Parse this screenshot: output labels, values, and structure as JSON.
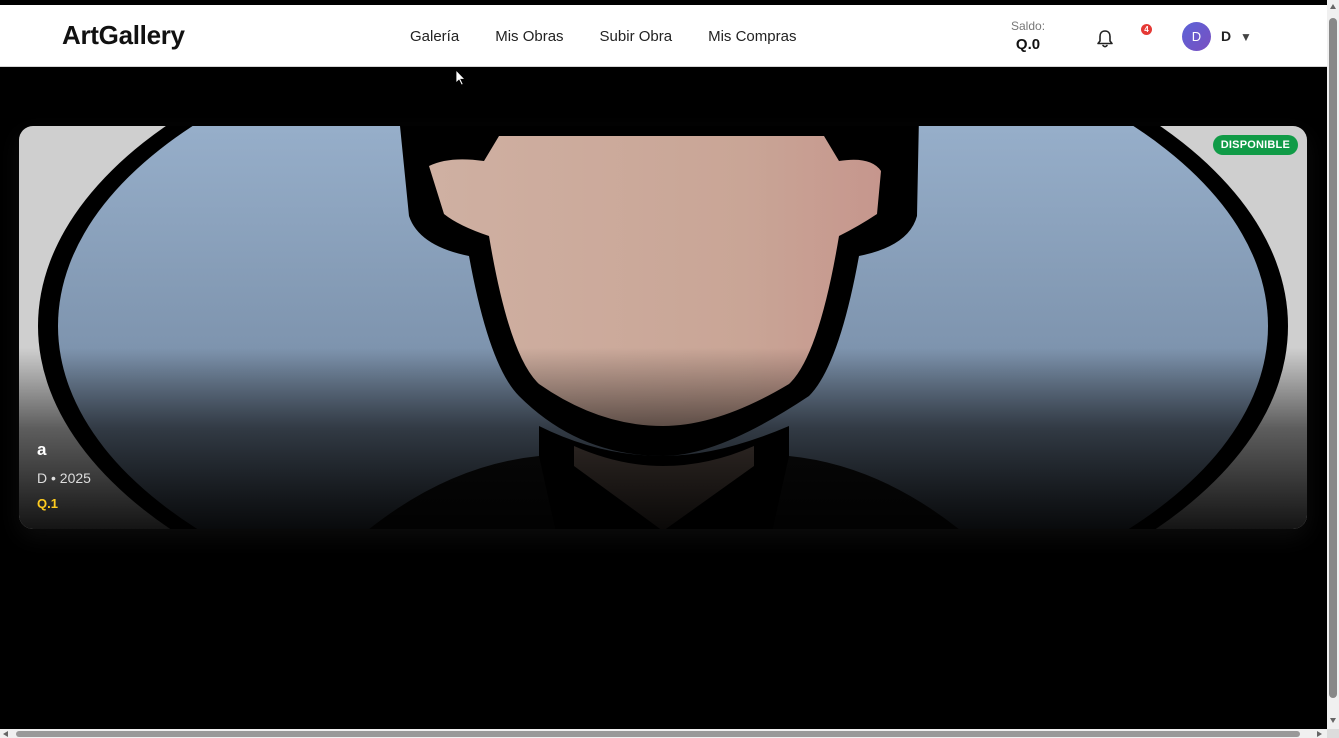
{
  "header": {
    "brand": "ArtGallery",
    "nav": [
      {
        "label": "Galería"
      },
      {
        "label": "Mis Obras"
      },
      {
        "label": "Subir Obra"
      },
      {
        "label": "Mis Compras"
      }
    ],
    "balance_label": "Saldo:",
    "balance_value": "Q.0",
    "notification_icon": "bell-icon",
    "notification_count": "4",
    "avatar_initial": "D",
    "user_name": "D",
    "user_menu_icon": "caret-down-icon"
  },
  "artwork": {
    "status": "DISPONIBLE",
    "title": "a",
    "meta": "D • 2025",
    "price": "Q.1",
    "colors": {
      "status_badge": "#109b47",
      "price": "#ffcc1f"
    }
  }
}
